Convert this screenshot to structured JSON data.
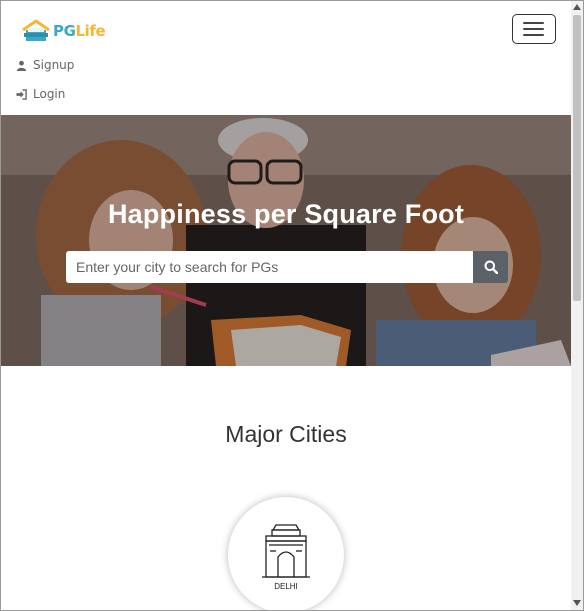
{
  "brand": {
    "part1": "PG",
    "part2": "Life",
    "colors": {
      "primary": "#3aa9c9",
      "accent": "#f5b733"
    }
  },
  "nav": {
    "toggler_icon": "hamburger-icon",
    "links": [
      {
        "label": "Signup",
        "icon": "user-icon"
      },
      {
        "label": "Login",
        "icon": "sign-in-icon"
      }
    ]
  },
  "banner": {
    "title": "Happiness per Square Foot",
    "search_placeholder": "Enter your city to search for PGs",
    "search_icon": "search-icon"
  },
  "cities_section": {
    "title": "Major Cities",
    "cities": [
      {
        "name": "DELHI",
        "icon": "india-gate-icon"
      }
    ]
  }
}
